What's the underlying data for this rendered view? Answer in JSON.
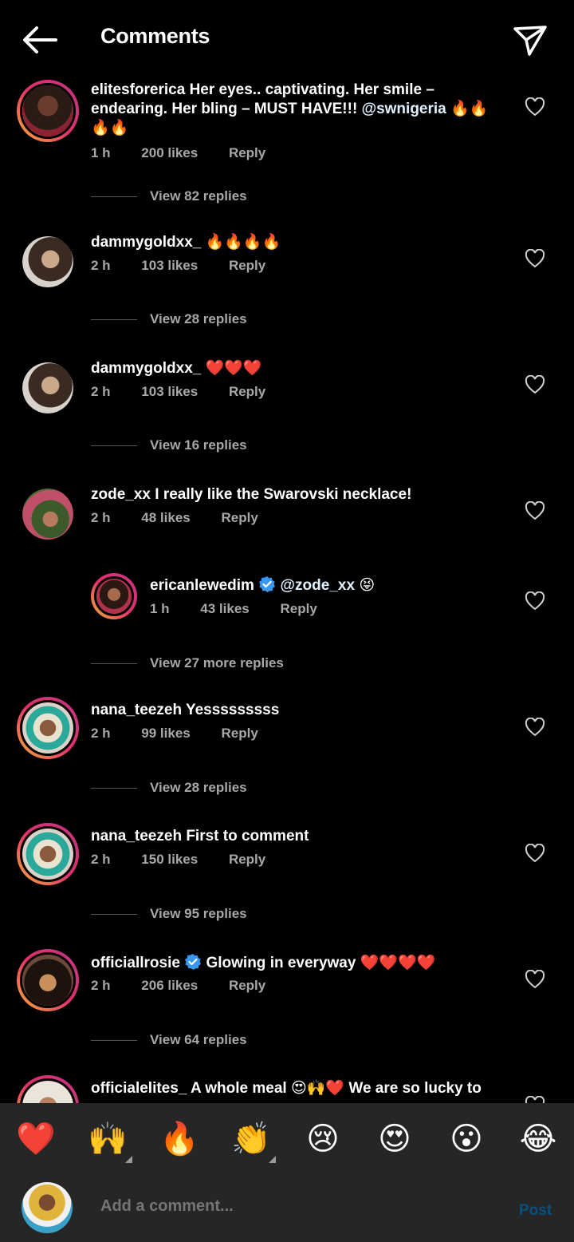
{
  "header": {
    "title": "Comments",
    "back_icon": "arrow-left-icon",
    "send_icon": "paper-plane-icon"
  },
  "comments": [
    {
      "user": "elitesforerica",
      "text": "Her eyes.. captivating. Her smile – endearing. Her bling – MUST HAVE!!! ",
      "mention": "@swnigeria",
      "emoji": "🔥🔥🔥🔥",
      "time": "1 h",
      "likes": "200 likes",
      "reply": "Reply",
      "view_replies": "View 82 replies"
    },
    {
      "user": "dammygoldxx_",
      "text": "",
      "emoji": "🔥🔥🔥🔥",
      "time": "2 h",
      "likes": "103 likes",
      "reply": "Reply",
      "view_replies": "View 28 replies"
    },
    {
      "user": "dammygoldxx_",
      "text": "",
      "emoji": "❤️❤️❤️",
      "time": "2 h",
      "likes": "103 likes",
      "reply": "Reply",
      "view_replies": "View 16 replies"
    },
    {
      "user": "zode_xx",
      "text": "I really like the Swarovski necklace!",
      "time": "2 h",
      "likes": "48 likes",
      "reply": "Reply"
    },
    {
      "user": "ericanlewedim",
      "verified": true,
      "mention": "@zode_xx",
      "emoji": "😝",
      "time": "1 h",
      "likes": "43 likes",
      "reply": "Reply",
      "view_replies": "View 27 more replies"
    },
    {
      "user": "nana_teezeh",
      "text": "Yesssssssss",
      "time": "2 h",
      "likes": "99 likes",
      "reply": "Reply",
      "view_replies": "View 28 replies"
    },
    {
      "user": "nana_teezeh",
      "text": "First to comment",
      "time": "2 h",
      "likes": "150 likes",
      "reply": "Reply",
      "view_replies": "View 95 replies"
    },
    {
      "user": "officiallrosie",
      "verified": true,
      "text": "Glowing in everyway",
      "emoji": "❤️❤️❤️❤️",
      "time": "2 h",
      "likes": "206 likes",
      "reply": "Reply",
      "view_replies": "View 64 replies"
    },
    {
      "user": "officialelites_",
      "text": "A whole meal ",
      "emoji": "😍🙌❤️",
      "text2": " We are so lucky to"
    }
  ],
  "emoji_bar": [
    "❤️",
    "🙌",
    "🔥",
    "👏",
    "😢",
    "😍",
    "😮",
    "😂"
  ],
  "input": {
    "placeholder": "Add a comment...",
    "post_label": "Post"
  },
  "colors": {
    "background": "#000000",
    "bar": "#262626",
    "muted": "#a8a8a8",
    "verified": "#3897f0",
    "post": "#0b4f7e"
  }
}
